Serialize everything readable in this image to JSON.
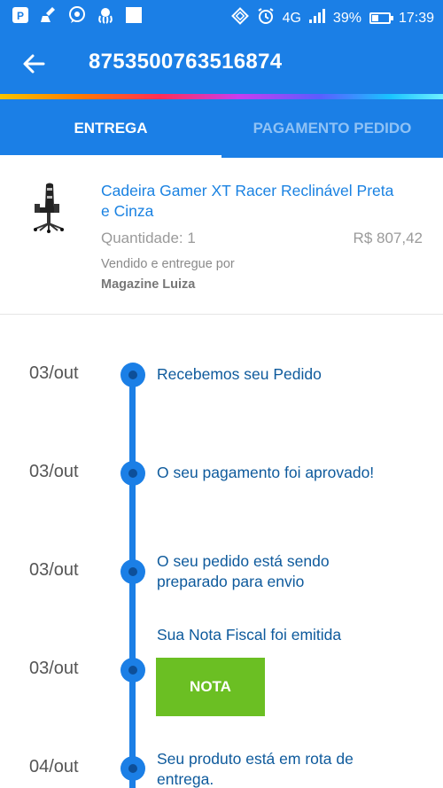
{
  "status_bar": {
    "network": "4G",
    "battery_text": "39%",
    "battery_level": 0.39,
    "time": "17:39",
    "left_icons": [
      "parking-app-icon",
      "cleaner-icon",
      "whatsapp-icon",
      "octopus-app-icon",
      "blank-square-icon"
    ]
  },
  "toolbar": {
    "title": "8753500763516874"
  },
  "tabs": [
    {
      "label": "ENTREGA",
      "active": true
    },
    {
      "label": "PAGAMENTO PEDIDO",
      "active": false
    }
  ],
  "product": {
    "name": "Cadeira Gamer XT Racer Reclinável Preta e Cinza",
    "quantity_label": "Quantidade: 1",
    "price": "R$ 807,42",
    "seller_label": "Vendido e entregue por",
    "seller_name": "Magazine Luiza"
  },
  "timeline": [
    {
      "date": "03/out",
      "text": "Recebemos seu Pedido"
    },
    {
      "date": "03/out",
      "text": "O seu pagamento foi aprovado!"
    },
    {
      "date": "03/out",
      "text": "O seu pedido está sendo preparado para envio"
    },
    {
      "date": "03/out",
      "text": "Sua Nota Fiscal foi emitida",
      "button": "NOTA"
    },
    {
      "date": "04/out",
      "text": "Seu produto está em rota de entrega."
    }
  ],
  "colors": {
    "primary": "#1b7fe6",
    "link": "#1a82e2",
    "timeline_text": "#0e5a9c",
    "nota_button": "#6bbf23"
  }
}
